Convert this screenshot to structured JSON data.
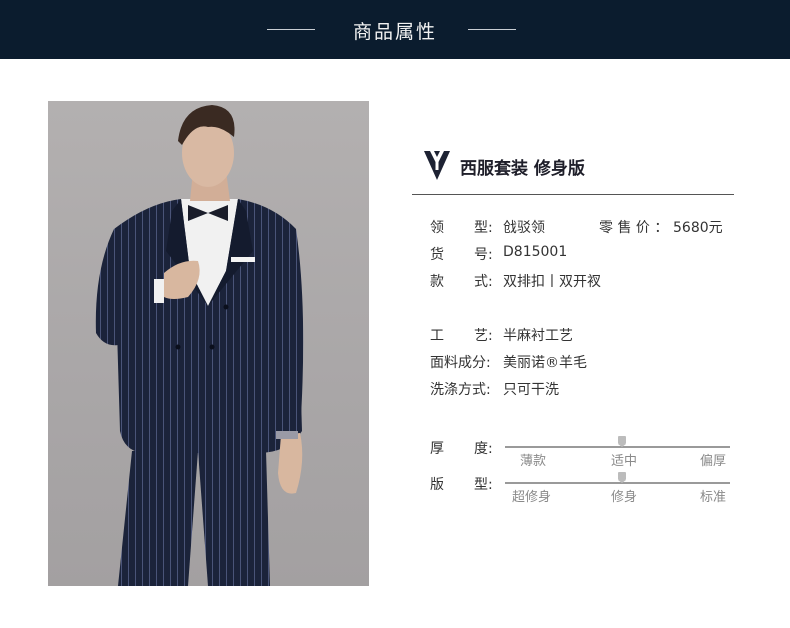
{
  "header": {
    "title": "商品属性"
  },
  "brand": {
    "name": "西服套装  修身版"
  },
  "specs": {
    "collar": {
      "k1": "领",
      "k2": "型",
      "sep": ":",
      "value": "戗驳领"
    },
    "price": {
      "label": "零 售 价 ：",
      "value": "5680元"
    },
    "item_no": {
      "k1": "货",
      "k2": "号",
      "sep": ":",
      "value": "D815001"
    },
    "style": {
      "k1": "款",
      "k2": "式",
      "sep": ":",
      "value": "双排扣丨双开衩"
    },
    "craft": {
      "k1": "工",
      "k2": "艺",
      "sep": ":",
      "value": "半麻衬工艺"
    },
    "fabric": {
      "label": "面料成分",
      "sep": ":",
      "value": "美丽诺®羊毛"
    },
    "wash": {
      "label": "洗涤方式",
      "sep": ":",
      "value": "只可干洗"
    }
  },
  "thickness": {
    "k1": "厚",
    "k2": "度",
    "sep": ":",
    "options": [
      "薄款",
      "适中",
      "偏厚"
    ],
    "level": 0.52
  },
  "fit": {
    "k1": "版",
    "k2": "型",
    "sep": ":",
    "options": [
      "超修身",
      "修身",
      "标准"
    ],
    "level": 0.52
  },
  "icons": {
    "brand_logo": "suit-collar-logo-icon"
  },
  "colors": {
    "header_bg": "#0b1c2e",
    "suit": "#1a2238",
    "photo_bg": "#aeabac"
  }
}
